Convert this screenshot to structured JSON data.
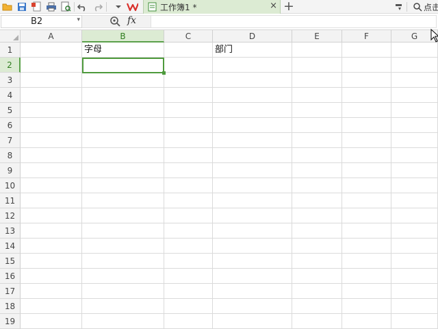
{
  "toolbar": {
    "icons": [
      "open-folder-icon",
      "save-icon",
      "export-pdf-icon",
      "print-icon",
      "print-preview-icon",
      "undo-icon",
      "redo-icon",
      "dropdown-arrow-icon",
      "wps-logo-icon",
      "sheet-doc-icon",
      "settings-icon",
      "search-icon"
    ],
    "tab_title": "工作簿1 *",
    "tab_close": "×",
    "tab_add": "+",
    "search_label": "点击"
  },
  "formula_bar": {
    "cell_ref": "B2",
    "dropdown_arrow": "▾",
    "fx_label": "fx",
    "formula_value": ""
  },
  "sheet": {
    "columns": [
      "A",
      "B",
      "C",
      "D",
      "E",
      "F",
      "G"
    ],
    "rows": [
      "1",
      "2",
      "3",
      "4",
      "5",
      "6",
      "7",
      "8",
      "9",
      "10",
      "11",
      "12",
      "13",
      "14",
      "15",
      "16",
      "17",
      "18",
      "19"
    ],
    "selected_column": "B",
    "selected_row": "2",
    "cells": {
      "B1": "字母",
      "D1": "部门"
    }
  },
  "colors": {
    "accent_green": "#4e9a3c",
    "header_selected_bg": "#dcebd3",
    "header_bg": "#f3f3f3",
    "gridline": "#dadada"
  }
}
